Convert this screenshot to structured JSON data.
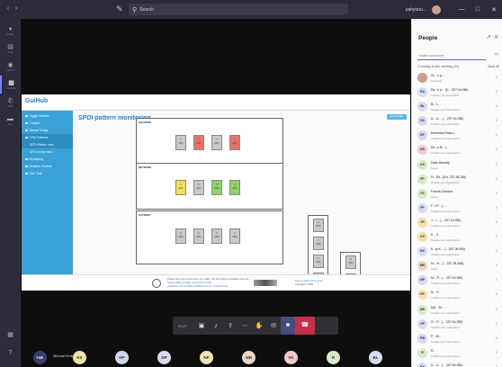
{
  "titlebar": {
    "search_placeholder": "Search",
    "user": "yahyaou..."
  },
  "rail": [
    {
      "icon": "bell-icon",
      "label": "Activity"
    },
    {
      "icon": "chat-icon",
      "label": "Chat"
    },
    {
      "icon": "teams-icon",
      "label": "Teams"
    },
    {
      "icon": "calendar-icon",
      "label": "Calendar"
    },
    {
      "icon": "phone-icon",
      "label": "Calls"
    },
    {
      "icon": "files-icon",
      "label": "Files"
    }
  ],
  "share": {
    "app_name": "GuiHub",
    "page_title": "SPDI pattern monitoring",
    "action_button": "Refresh Data",
    "sidebar": [
      {
        "label": "Toggle Sidebar",
        "sub": false,
        "sel": false
      },
      {
        "label": "Content",
        "sub": false,
        "sel": false
      },
      {
        "label": "Almost Things",
        "sub": false,
        "sel": false
      },
      {
        "label": "SPDI Patterns",
        "sub": false,
        "sel": true
      },
      {
        "label": "SPDI Pattern view",
        "sub": true,
        "sel": true
      },
      {
        "label": "SPDI image view",
        "sub": true,
        "sel": false
      },
      {
        "label": "Monitoring",
        "sub": false,
        "sel": false
      },
      {
        "label": "Rename Content",
        "sub": false,
        "sel": false
      },
      {
        "label": "SBO Test",
        "sub": false,
        "sel": false
      }
    ],
    "groups": [
      {
        "label": "BACKEND",
        "tiles": [
          {
            "top": "0",
            "bottom": "(0/0)",
            "color": "#c8c8c8"
          },
          {
            "top": "0",
            "bottom": "(0/0)",
            "color": "#e8736b"
          },
          {
            "top": "0",
            "bottom": "(0/0)",
            "color": "#c8c8c8"
          },
          {
            "top": "1",
            "bottom": "(0/1)",
            "color": "#e8736b"
          }
        ]
      },
      {
        "label": "NETWORK",
        "tiles": [
          {
            "top": "0",
            "bottom": "(0/0)",
            "color": "#f1e05a"
          },
          {
            "top": "0",
            "bottom": "(0/0)",
            "color": "#c8c8c8"
          },
          {
            "top": "0",
            "bottom": "(0/0)",
            "color": "#8fd16a"
          },
          {
            "top": "1",
            "bottom": "(0/1)",
            "color": "#8fd16a"
          }
        ]
      },
      {
        "label": "GATEWAY",
        "tiles": [
          {
            "top": "0",
            "bottom": "(0/0)",
            "color": "#c8c8c8"
          },
          {
            "top": "0",
            "bottom": "(0/0)",
            "color": "#c8c8c8"
          },
          {
            "top": "0",
            "bottom": "(0/0)",
            "color": "#c8c8c8"
          },
          {
            "top": "0",
            "bottom": "(0/0)",
            "color": "#c8c8c8"
          }
        ]
      }
    ],
    "column_a": [
      {
        "top": "0",
        "bottom": "(0/0)"
      },
      {
        "top": "0",
        "bottom": "(0/0)"
      },
      {
        "top": "0",
        "bottom": "(0/0)"
      },
      {
        "top": "1",
        "bottom": "(0/1)"
      },
      {
        "top": "0",
        "bottom": "(0/0)"
      },
      {
        "top": "0",
        "bottom": "(0/0)"
      },
      {
        "top": "0",
        "bottom": "(0/0)"
      }
    ],
    "column_b": [
      {
        "top": "0",
        "bottom": "(0/0)"
      },
      {
        "top": "0",
        "bottom": "(0/0)"
      },
      {
        "top": "0",
        "bottom": "(0/0)"
      },
      {
        "top": "0",
        "bottom": "(0/0)"
      }
    ],
    "footer": {
      "text1": "Please keep your environment up to date. The information is available from the",
      "text2": "Guihub 2020 and SBO Connections Portal",
      "text3": "guidelines and use SBO Conditions of Use - Privacy Policy",
      "text4": "Send to MachCIT by email",
      "text5": "Copyright © 2020"
    }
  },
  "controls": {
    "time": "03:27"
  },
  "presenter": "Michael Kotup",
  "stage_avatars": [
    {
      "initials": "+16",
      "color": "#3a3d6b",
      "text": "#ffffff"
    },
    {
      "initials": "KS",
      "color": "#f1e0a8",
      "text": "#333333"
    },
    {
      "initials": "HP",
      "color": "#cfd7ef",
      "text": "#333333"
    },
    {
      "initials": "DP",
      "color": "#d8d8f2",
      "text": "#333333"
    },
    {
      "initials": "NP",
      "color": "#f6e0b4",
      "text": "#333333"
    },
    {
      "initials": "MR",
      "color": "#e9d5c2",
      "text": "#333333"
    },
    {
      "initials": "VK",
      "color": "#f2c9cf",
      "text": "#333333"
    },
    {
      "initials": "R",
      "color": "#d8e9c9",
      "text": "#333333"
    },
    {
      "initials": "BL",
      "color": "#d6dcf2",
      "text": "#333333"
    }
  ],
  "people": {
    "title": "People",
    "invite_placeholder": "Invite someone",
    "section": "Currently in this meeting (21)",
    "mute_all": "Mute all",
    "members": [
      {
        "initials": "",
        "name": "Gr... k.p...",
        "sub": "Organizer",
        "color": "#c8a08a"
      },
      {
        "initials": "RA",
        "name": "Ra...h A... (E... 2S7-IN-SBI)",
        "sub": "Outside your organization",
        "color": "#d6dcf2"
      },
      {
        "initials": "BL",
        "name": "B... L...",
        "sub": "Outside your organization",
        "color": "#d6dcf2"
      },
      {
        "initials": "DA",
        "name": "D... A.... (... 2S7-IN-SBI)",
        "sub": "Outside your organization",
        "color": "#d8d8f2"
      },
      {
        "initials": "DP",
        "name": "Devendra Patra (...",
        "sub": "Outside your organization",
        "color": "#d8d8f2"
      },
      {
        "initials": "DR",
        "name": "Dh...a R... (...",
        "sub": "Outside your organization",
        "color": "#f2c9cf"
      },
      {
        "initials": "DS",
        "name": "Dadu Baranty",
        "sub": "Guest",
        "color": "#d8e9c9"
      },
      {
        "initials": "FP",
        "name": "Fr...Eh...(Ext. 2S7-IN-SBI)",
        "sub": "Outside your organization",
        "color": "#d8e9c9"
      },
      {
        "initials": "FS",
        "name": "Francis Sambra",
        "sub": "Guest",
        "color": "#d8e9c9"
      },
      {
        "initials": "FP",
        "name": "F...t P... (...",
        "sub": "Outside your organization",
        "color": "#d6dcf2"
      },
      {
        "initials": "JR",
        "name": "J... I... (... 2S7-IN-SBI)",
        "sub": "Outside your organization",
        "color": "#f1e0a8"
      },
      {
        "initials": "KS",
        "name": "K... S...",
        "sub": "Outside your organization",
        "color": "#f1e0a8"
      },
      {
        "initials": "KK",
        "name": "K...ty K... (... 2S7-IN-SBI)",
        "sub": "Outside your organization",
        "color": "#d6dcf2"
      },
      {
        "initials": "MR",
        "name": "M... R... (... 2S7-IN-SBI)",
        "sub": "Guest",
        "color": "#e9d5c2"
      },
      {
        "initials": "MP",
        "name": "M... P... (... 2S7-IN-SBI)",
        "sub": "Outside your organization",
        "color": "#d8d8f2"
      },
      {
        "initials": "NP",
        "name": "N... P...",
        "sub": "Outside your organization",
        "color": "#f6e0b4"
      },
      {
        "initials": "NB",
        "name": "Nyl... Br...",
        "sub": "Outside your organization",
        "color": "#d8e9c9"
      },
      {
        "initials": "OP",
        "name": "O... P... (... 2S7-IN-SBI)",
        "sub": "Outside your organization",
        "color": "#d6dcf2"
      },
      {
        "initials": "PW",
        "name": "P... W...",
        "sub": "Outside your organization",
        "color": "#d8d8f2"
      },
      {
        "initials": "R",
        "name": "R...",
        "sub": "Outside your organization",
        "color": "#d8e9c9"
      },
      {
        "initials": "RA",
        "name": "R... A... (... 2S7-IN-SBI)",
        "sub": "Outside your organization",
        "color": "#d6dcf2"
      }
    ]
  }
}
